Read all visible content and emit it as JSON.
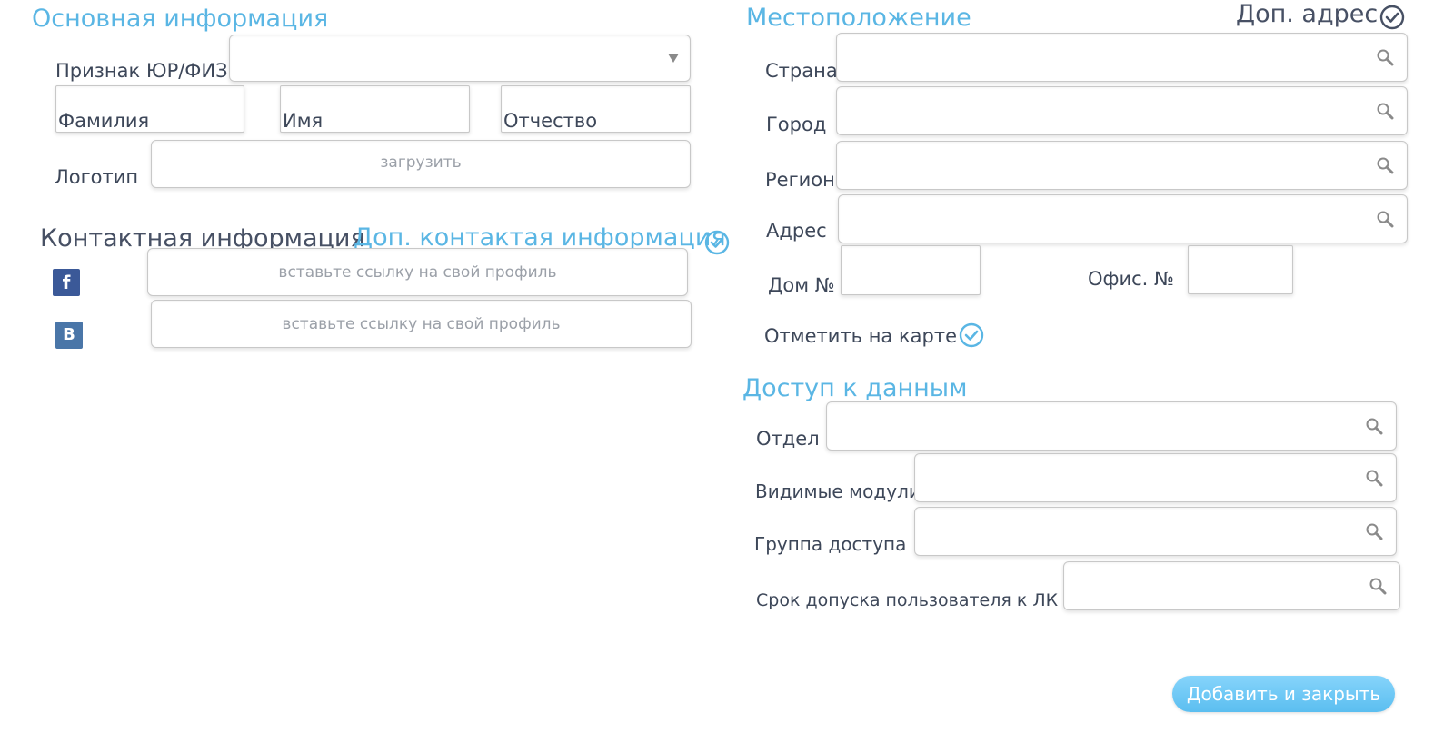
{
  "basic": {
    "title": "Основная информация",
    "entity_type_label": "Признак ЮР/ФИЗ",
    "entity_type_value": "",
    "surname_label": "Фамилия",
    "name_label": "Имя",
    "patronymic_label": "Отчество",
    "logo_label": "Логотип",
    "logo_upload": "загрузить"
  },
  "contact": {
    "title": "Контактная информация",
    "extra_link": "Доп. контактая информация",
    "facebook_letter": "f",
    "vk_letter": "B",
    "facebook_placeholder": "вставьте ссылку на свой профиль",
    "vk_placeholder": "вставьте ссылку на свой профиль"
  },
  "location": {
    "title": "Местоположение",
    "extra_address": "Доп. адрес",
    "country_label": "Страна",
    "city_label": "Город",
    "region_label": "Регион",
    "address_label": "Адрес",
    "house_label": "Дом №",
    "office_label": "Офис. №",
    "map_label": "Отметить на карте"
  },
  "access": {
    "title": "Доступ к данным",
    "department_label": "Отдел",
    "modules_label": "Видимые модули",
    "group_label": "Группа доступа",
    "term_label": "Срок допуска пользователя к ЛК"
  },
  "actions": {
    "submit_label": "Добавить и закрыть"
  },
  "colors": {
    "accent": "#5ab6e4",
    "heading_dark": "#475064",
    "facebook": "#3b5998",
    "vk": "#4a76a8"
  },
  "icons": [
    "search-icon",
    "dropdown-arrow-icon",
    "check-circle-icon",
    "facebook-icon",
    "vk-icon"
  ]
}
